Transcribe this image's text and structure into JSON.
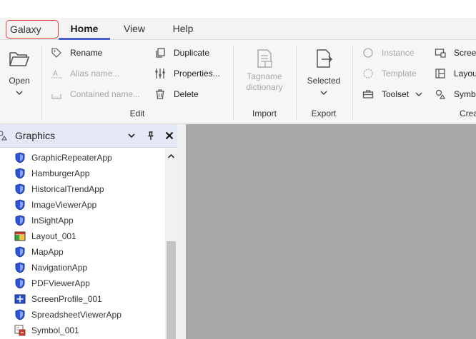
{
  "tabs": {
    "galaxy": "Galaxy",
    "home": "Home",
    "view": "View",
    "help": "Help"
  },
  "ribbon": {
    "open": {
      "label": "Open"
    },
    "edit": {
      "label": "Edit",
      "rename": "Rename",
      "alias_name": "Alias name...",
      "contained_name": "Contained name...",
      "duplicate": "Duplicate",
      "properties": "Properties...",
      "delete": "Delete"
    },
    "import": {
      "label": "Import",
      "tagname_line1": "Tagname",
      "tagname_line2": "dictionary"
    },
    "export": {
      "label": "Export",
      "selected": "Selected"
    },
    "create": {
      "label": "Crea",
      "instance": "Instance",
      "template": "Template",
      "toolset": "Toolset",
      "screen": "Scree",
      "layout": "Layou",
      "symbol": "Symb"
    }
  },
  "panel": {
    "title": "Graphics",
    "items": [
      {
        "label": "GraphicRepeaterApp",
        "icon": "shield-app-icon"
      },
      {
        "label": "HamburgerApp",
        "icon": "shield-app-icon"
      },
      {
        "label": "HistoricalTrendApp",
        "icon": "shield-app-icon"
      },
      {
        "label": "ImageViewerApp",
        "icon": "shield-app-icon"
      },
      {
        "label": "InSightApp",
        "icon": "shield-app-icon"
      },
      {
        "label": "Layout_001",
        "icon": "layout-icon"
      },
      {
        "label": "MapApp",
        "icon": "shield-app-icon"
      },
      {
        "label": "NavigationApp",
        "icon": "shield-app-icon"
      },
      {
        "label": "PDFViewerApp",
        "icon": "shield-app-icon"
      },
      {
        "label": "ScreenProfile_001",
        "icon": "screen-profile-icon"
      },
      {
        "label": "SpreadsheetViewerApp",
        "icon": "shield-app-icon"
      },
      {
        "label": "Symbol_001",
        "icon": "symbol-icon"
      }
    ]
  },
  "colors": {
    "accent": "#4a5fc7",
    "highlight": "#e2413b",
    "canvas": "#a8a8a8"
  }
}
